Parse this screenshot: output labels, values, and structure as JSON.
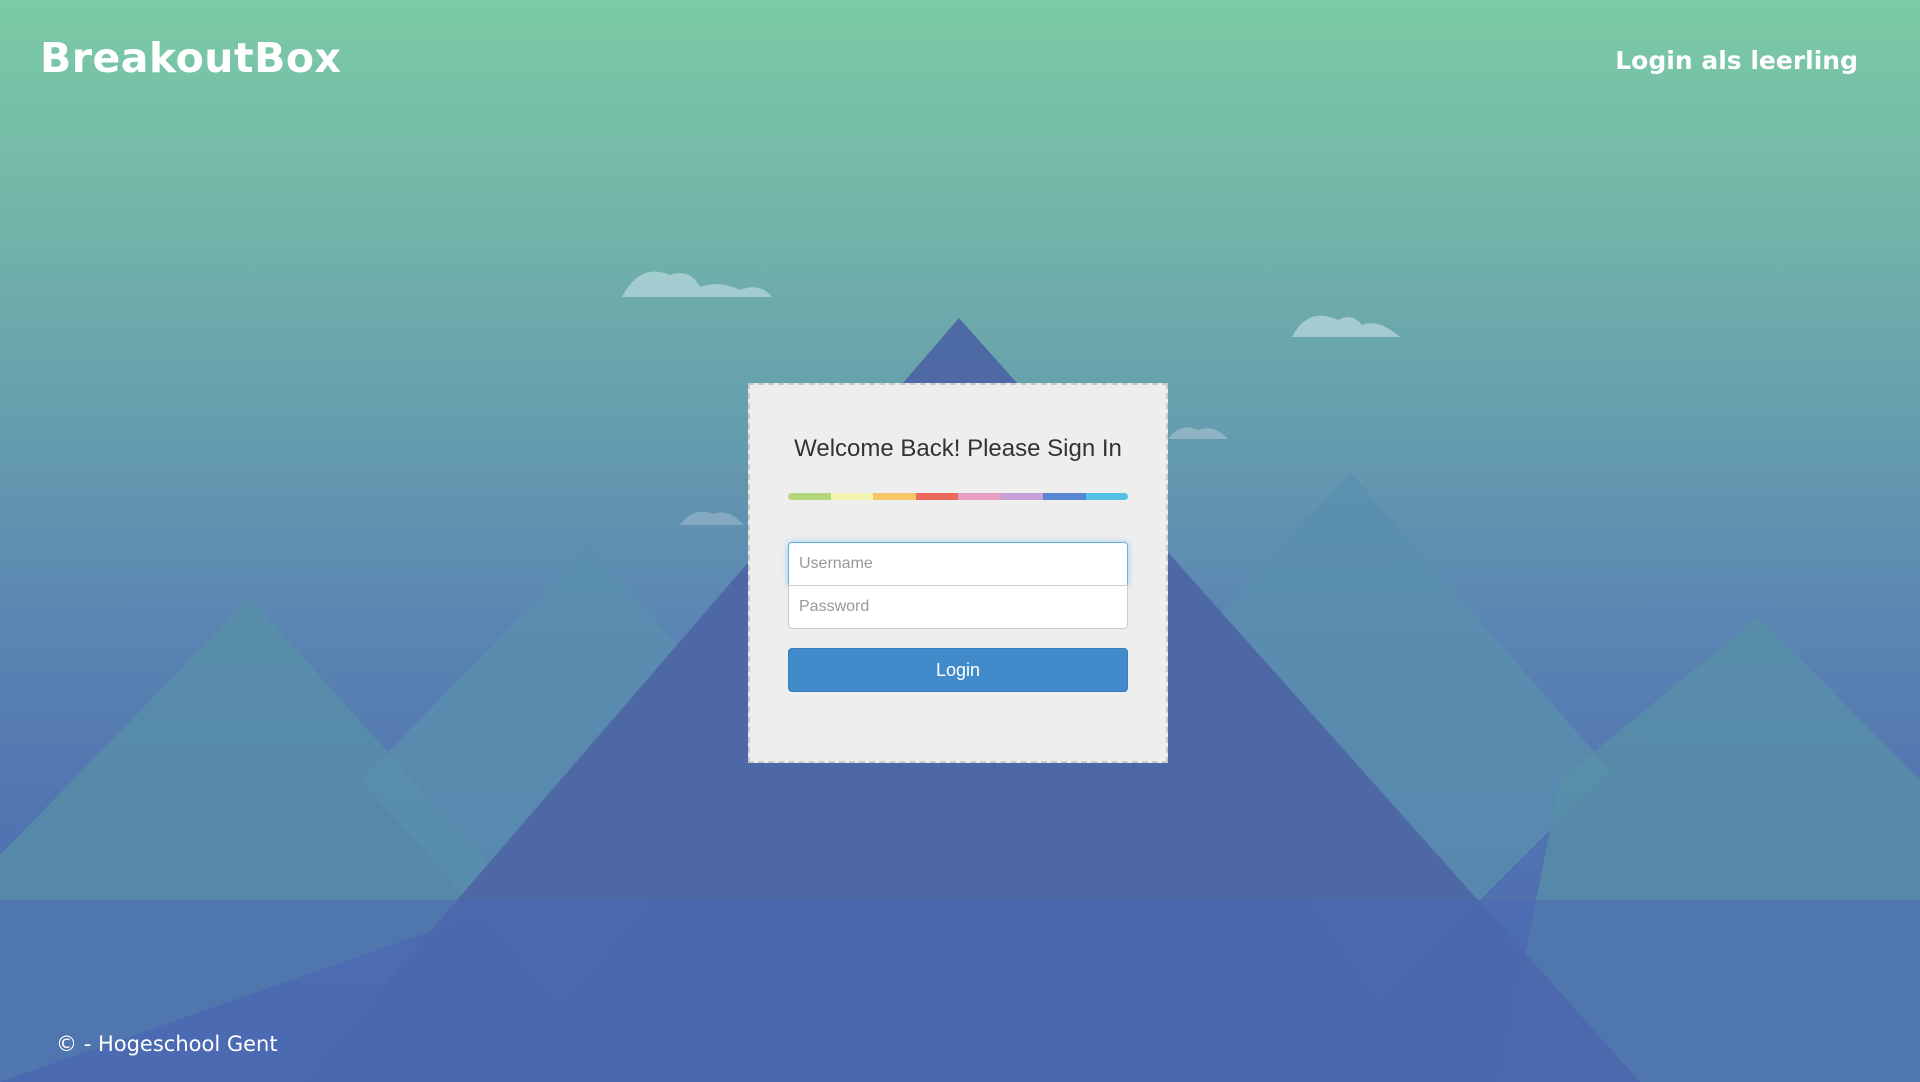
{
  "header": {
    "logo_text": "BreakoutBox",
    "student_login_link": "Login als leerling"
  },
  "login_form": {
    "title": "Welcome Back! Please Sign In",
    "username_placeholder": "Username",
    "password_placeholder": "Password",
    "login_button": "Login",
    "divider_colors": [
      "#b5d77c",
      "#f2f4b1",
      "#f6c667",
      "#ec6a5c",
      "#e89fbf",
      "#c79fd8",
      "#5a87d1",
      "#55c0e6"
    ]
  },
  "footer": {
    "copyright_symbol": "©",
    "copyright_text": "- Hogeschool Gent"
  },
  "background": {
    "description_icon": "mountains-illustration"
  }
}
